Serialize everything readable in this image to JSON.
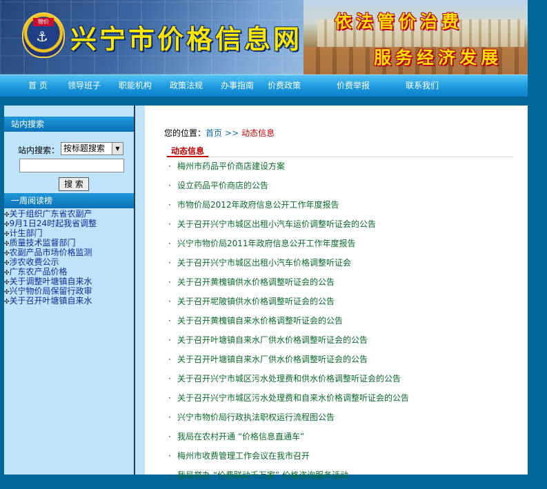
{
  "header": {
    "emblem_tag": "物价",
    "site_title": "兴宁市价格信息网",
    "slogan_1": "依法管价治费",
    "slogan_2": "服务经济发展"
  },
  "nav": {
    "items": [
      "首 页",
      "领导班子",
      "职能机构",
      "政策法规",
      "办事指南",
      "价费政策",
      "价费举报",
      "联系我们"
    ]
  },
  "sidebar": {
    "search_title": "站内搜索",
    "search_label": "站内搜索：",
    "search_select_value": "按标题搜索",
    "search_input_value": "",
    "search_button": "搜 索",
    "weekly_title": "一周阅读榜",
    "weekly_items": [
      "关于组织广东省农副产",
      "9月1日24时起我省调整",
      "计生部门",
      "质量技术监督部门",
      "农副产品市场价格监测",
      "涉农收费公示",
      "广东农产品价格",
      "关于调整叶塘镇自来水",
      "兴宁物价局保留行政审",
      "关于召开叶塘镇自来水"
    ]
  },
  "main": {
    "breadcrumb_prefix": "您的位置：",
    "breadcrumb_home": "首页",
    "breadcrumb_sep": ">>",
    "breadcrumb_current": "动态信息",
    "section_title": "动态信息",
    "news": [
      "梅州市药品平价商店建设方案",
      "设立药品平价商店的公告",
      "市物价局2012年政府信息公开工作年度报告",
      "关于召开兴宁市城区出租小汽车运价调整听证会的公告",
      "兴宁市物价局2011年政府信息公开工作年度报告",
      "关于召开兴宁市城区出租小汽车价格调整听证会",
      "关于召开黄槐镇供水价格调整听证会的公告",
      "关于召开坭陂镇供水价格调整听证会的公告",
      "关于召开黄槐镇自来水价格调整听证会的公告",
      "关于召开叶塘镇自来水厂供水价格调整听证会的公告",
      "关于召开叶塘镇自来水厂供水价格调整听证会的公告",
      "关于召开兴宁市城区污水处理费和供水价格调整听证会的公告",
      "关于召开兴宁市城区污水处理费和自来水价格调整听证会的公告",
      "兴宁市物价局行政执法职权运行流程图公告",
      "我局在农村开通 “价格信息直通车”",
      "梅州市收费管理工作会议在我市召开",
      "我局举办 “价费联动千万家” 价格咨询服务活动"
    ]
  }
}
